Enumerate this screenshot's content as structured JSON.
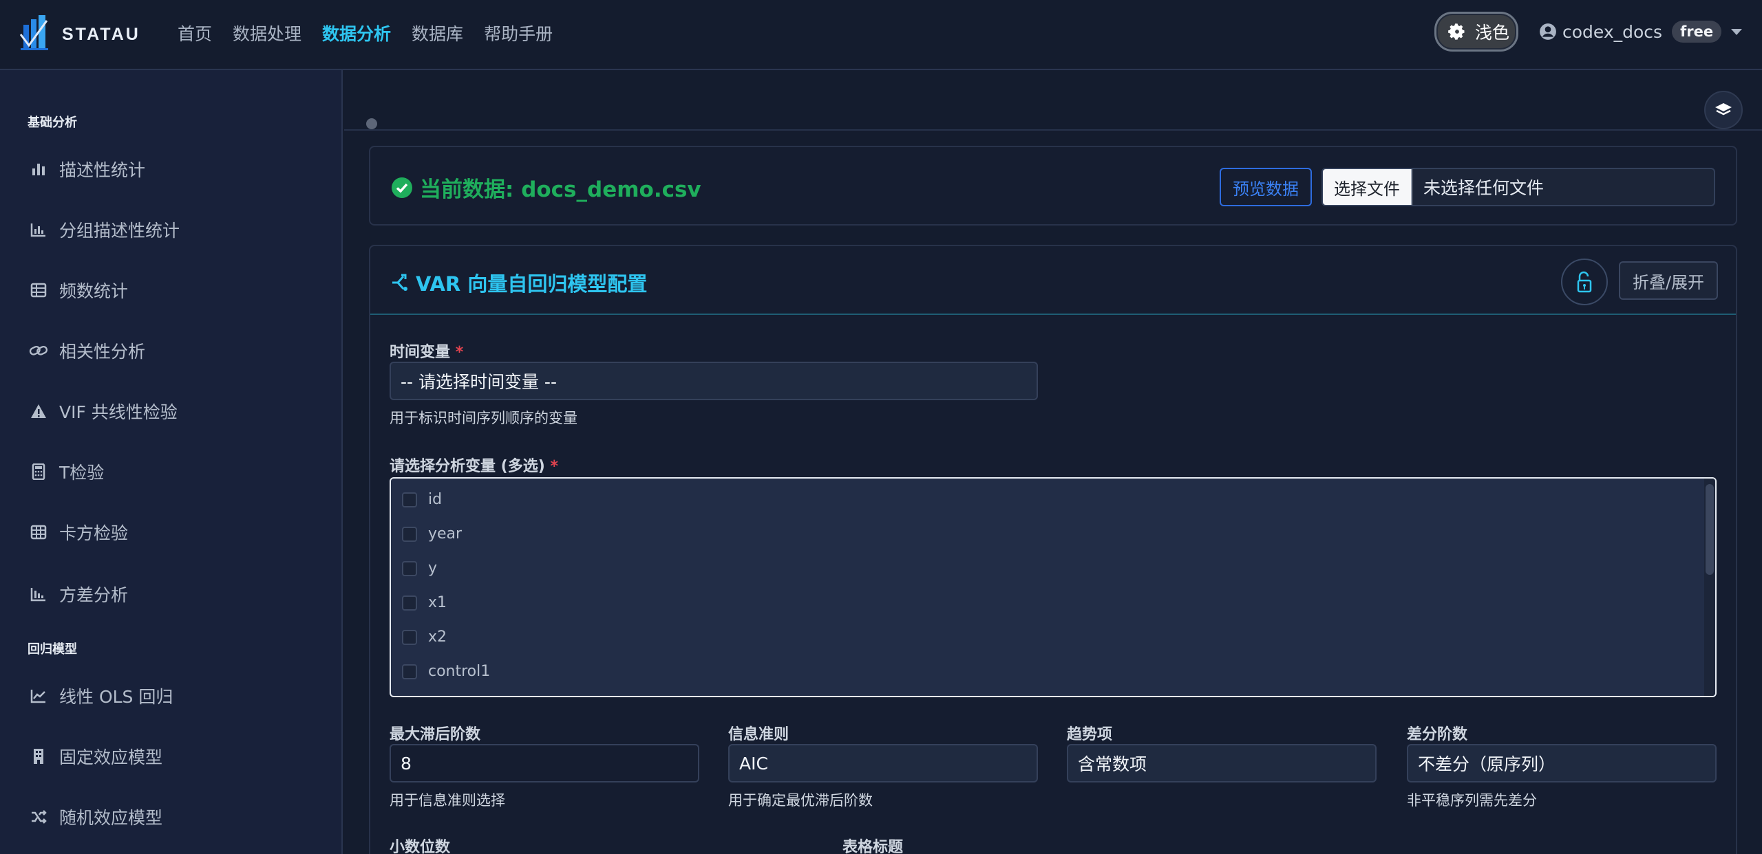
{
  "brand": {
    "logo_text": "STATAU"
  },
  "nav": {
    "items": [
      {
        "label": "首页",
        "active": false
      },
      {
        "label": "数据处理",
        "active": false
      },
      {
        "label": "数据分析",
        "active": true
      },
      {
        "label": "数据库",
        "active": false
      },
      {
        "label": "帮助手册",
        "active": false
      }
    ]
  },
  "header_right": {
    "theme_label": "浅色",
    "username": "codex_docs",
    "plan_badge": "free"
  },
  "sidebar": {
    "sections": [
      {
        "title": "基础分析",
        "items": [
          {
            "label": "描述性统计",
            "icon": "bar-chart-icon"
          },
          {
            "label": "分组描述性统计",
            "icon": "grouped-chart-icon"
          },
          {
            "label": "频数统计",
            "icon": "table-icon"
          },
          {
            "label": "相关性分析",
            "icon": "link-icon"
          },
          {
            "label": "VIF 共线性检验",
            "icon": "warning-icon"
          },
          {
            "label": "T检验",
            "icon": "calculator-icon"
          },
          {
            "label": "卡方检验",
            "icon": "grid-icon"
          },
          {
            "label": "方差分析",
            "icon": "column-chart-icon"
          }
        ]
      },
      {
        "title": "回归模型",
        "items": [
          {
            "label": "线性 OLS 回归",
            "icon": "line-chart-icon"
          },
          {
            "label": "固定效应模型",
            "icon": "building-icon"
          },
          {
            "label": "随机效应模型",
            "icon": "shuffle-icon"
          }
        ]
      }
    ]
  },
  "data_card": {
    "title": "当前数据: docs_demo.csv",
    "preview_button": "预览数据",
    "choose_file_button": "选择文件",
    "no_file_text": "未选择任何文件"
  },
  "config": {
    "title": "VAR 向量自回归模型配置",
    "fold_button": "折叠/展开",
    "time_var": {
      "label": "时间变量",
      "required_mark": "*",
      "selected": "-- 请选择时间变量 --",
      "help": "用于标识时间序列顺序的变量"
    },
    "analysis_vars": {
      "label": "请选择分析变量 (多选)",
      "required_mark": "*",
      "options": [
        "id",
        "year",
        "y",
        "x1",
        "x2",
        "control1"
      ]
    },
    "max_lag": {
      "label": "最大滞后阶数",
      "value": "8",
      "help": "用于信息准则选择"
    },
    "criterion": {
      "label": "信息准则",
      "selected": "AIC",
      "help": "用于确定最优滞后阶数"
    },
    "trend": {
      "label": "趋势项",
      "selected": "含常数项"
    },
    "diff_order": {
      "label": "差分阶数",
      "selected": "不差分（原序列）",
      "help": "非平稳序列需先差分"
    },
    "decimals": {
      "label": "小数位数"
    },
    "table_title": {
      "label": "表格标题"
    }
  },
  "colors": {
    "accent": "#2ec5f0",
    "success": "#1fae5c",
    "required": "#e0434f",
    "background": "#141c2e"
  }
}
